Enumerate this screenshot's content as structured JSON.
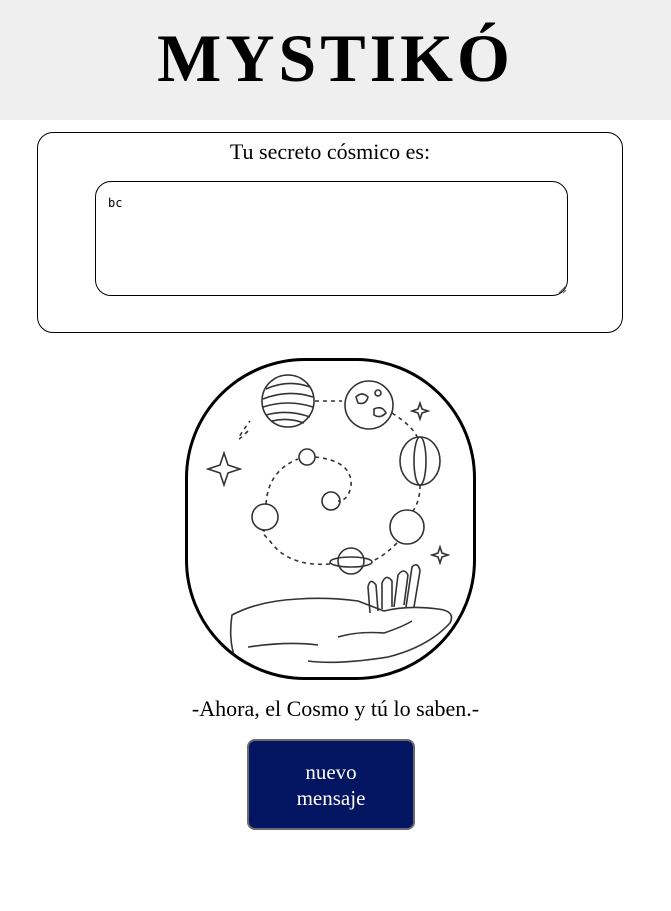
{
  "header": {
    "title": "MYSTIKÓ",
    "background": "#efefef"
  },
  "secret": {
    "label": "Tu secreto cósmico es:",
    "value": "bc"
  },
  "illustration": {
    "icon": "cosmic-hand-planets-illustration"
  },
  "tagline": "-Ahora, el Cosmo y tú lo saben.-",
  "actions": {
    "new_message_label": "nuevo mensaje",
    "button_color": "#041561"
  }
}
